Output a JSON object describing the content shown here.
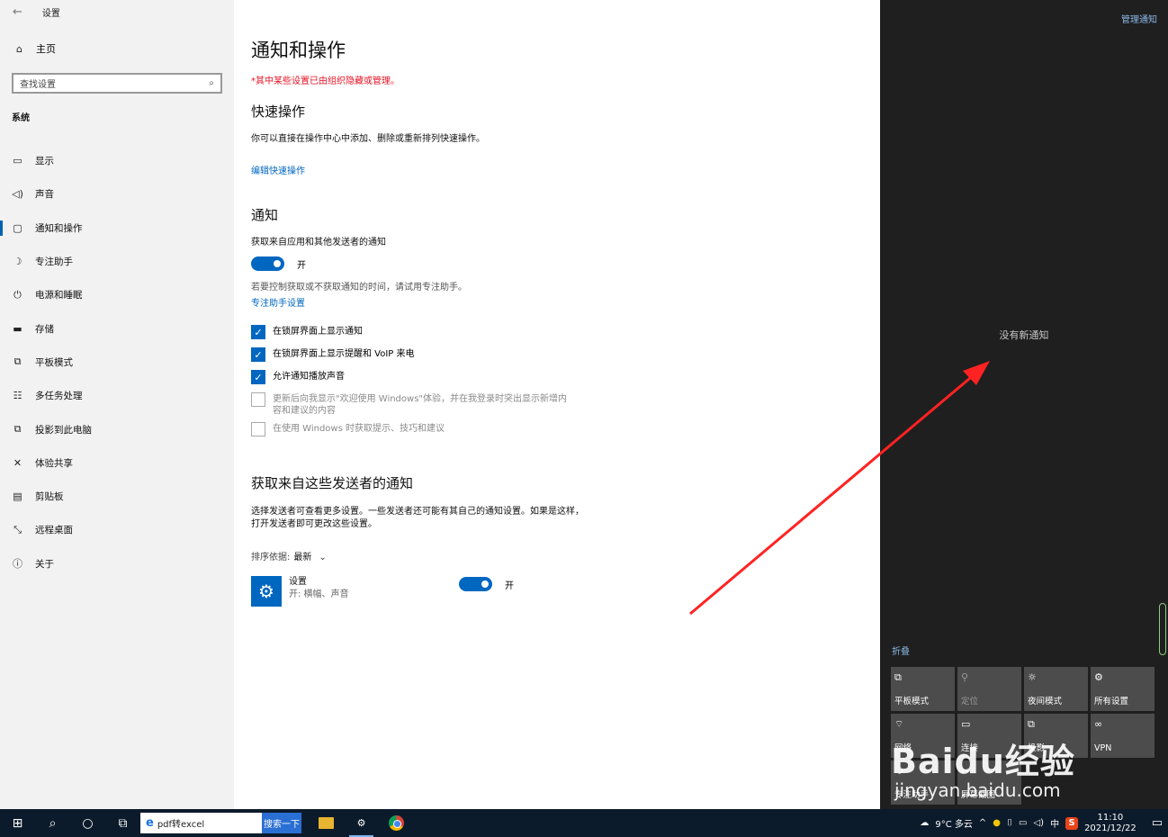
{
  "window": {
    "title": "设置"
  },
  "sidebar": {
    "home": "主页",
    "search_placeholder": "查找设置",
    "section": "系统",
    "items": [
      {
        "label": "显示",
        "icon": "monitor-icon"
      },
      {
        "label": "声音",
        "icon": "speaker-icon"
      },
      {
        "label": "通知和操作",
        "icon": "message-icon",
        "active": true
      },
      {
        "label": "专注助手",
        "icon": "moon-icon"
      },
      {
        "label": "电源和睡眠",
        "icon": "power-icon"
      },
      {
        "label": "存储",
        "icon": "storage-icon"
      },
      {
        "label": "平板模式",
        "icon": "tablet-icon"
      },
      {
        "label": "多任务处理",
        "icon": "multitask-icon"
      },
      {
        "label": "投影到此电脑",
        "icon": "project-icon"
      },
      {
        "label": "体验共享",
        "icon": "share-icon"
      },
      {
        "label": "剪贴板",
        "icon": "clipboard-icon"
      },
      {
        "label": "远程桌面",
        "icon": "remote-icon"
      },
      {
        "label": "关于",
        "icon": "info-icon"
      }
    ]
  },
  "main": {
    "title": "通知和操作",
    "warning": "*其中某些设置已由组织隐藏或管理。",
    "quick_actions": {
      "heading": "快速操作",
      "desc": "你可以直接在操作中心中添加、删除或重新排列快速操作。",
      "link": "编辑快速操作"
    },
    "notifications": {
      "heading": "通知",
      "get_label": "获取来自应用和其他发送者的通知",
      "toggle_state": "开",
      "focus_hint": "若要控制获取或不获取通知的时间，请试用专注助手。",
      "focus_link": "专注助手设置",
      "checkboxes": [
        {
          "label": "在锁屏界面上显示通知",
          "checked": true
        },
        {
          "label": "在锁屏界面上显示提醒和 VoIP 来电",
          "checked": true
        },
        {
          "label": "允许通知播放声音",
          "checked": true
        },
        {
          "label": "更新后向我显示\"欢迎使用 Windows\"体验，并在我登录时突出显示新增内容和建议的内容",
          "checked": false
        },
        {
          "label": "在使用 Windows 时获取提示、技巧和建议",
          "checked": false
        }
      ]
    },
    "senders": {
      "heading": "获取来自这些发送者的通知",
      "desc": "选择发送者可查看更多设置。一些发送者还可能有其自己的通知设置。如果是这样，打开发送者即可更改这些设置。",
      "sort_prefix": "排序依据:",
      "sort_value": "最新",
      "app_name": "设置",
      "app_sub": "开: 横幅、声音",
      "app_toggle": "开"
    }
  },
  "action_center": {
    "manage": "管理通知",
    "empty": "没有新通知",
    "collapse": "折叠",
    "tiles": [
      {
        "label": "平板模式",
        "icon": "tablet-mode-icon",
        "glyph": "⧉"
      },
      {
        "label": "定位",
        "icon": "location-icon",
        "glyph": "⚲",
        "dim": true
      },
      {
        "label": "夜间模式",
        "icon": "night-light-icon",
        "glyph": "☼"
      },
      {
        "label": "所有设置",
        "icon": "gear-icon",
        "glyph": "⚙"
      },
      {
        "label": "网络",
        "icon": "network-icon",
        "glyph": "⌔"
      },
      {
        "label": "连接",
        "icon": "connect-icon",
        "glyph": "▭"
      },
      {
        "label": "投影",
        "icon": "project-icon",
        "glyph": "⧉"
      },
      {
        "label": "VPN",
        "icon": "vpn-icon",
        "glyph": "∞"
      },
      {
        "label": "专注助手",
        "icon": "moon-icon",
        "glyph": "☽"
      },
      {
        "label": "屏幕截图",
        "icon": "snip-icon",
        "glyph": "✂"
      }
    ]
  },
  "watermark": {
    "brand": "Baidu经验",
    "url": "jingyan.baidu.com"
  },
  "taskbar": {
    "search_value": "pdf转excel",
    "search_button": "搜索一下",
    "weather": "9°C 多云",
    "ime": "中",
    "time": "11:10",
    "date": "2021/12/22"
  }
}
